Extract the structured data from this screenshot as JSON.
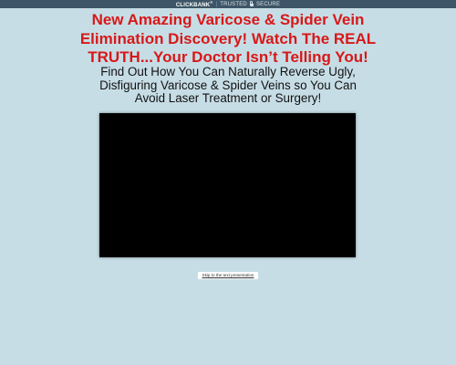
{
  "topbar": {
    "brand": "CLICKBANK",
    "brand_mark": "®",
    "separator": "|",
    "trusted": "TRUSTED",
    "secure": "SECURE"
  },
  "headline": {
    "line1": "New Amazing Varicose & Spider Vein",
    "line2": "Elimination Discovery! Watch The REAL",
    "line3": "TRUTH...Your Doctor Isn’t Telling You!",
    "color": "#d81818"
  },
  "subhead": {
    "line1": "Find Out How You Can Naturally Reverse Ugly,",
    "line2": "Disfiguring Varicose & Spider Veins so You Can",
    "line3": "Avoid Laser Treatment or Surgery!"
  },
  "skip_link": {
    "label": "Skip to the text presentation"
  },
  "colors": {
    "background": "#c7dde6",
    "topbar": "#3d5566",
    "video": "#000000"
  }
}
